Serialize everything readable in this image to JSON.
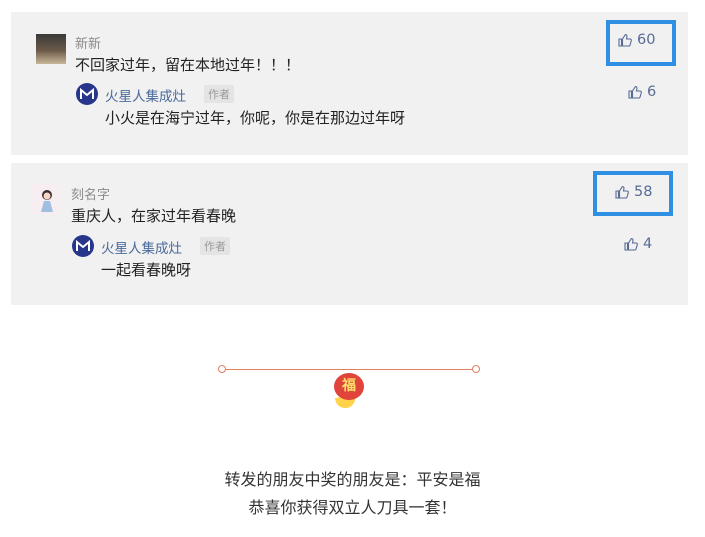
{
  "comments": [
    {
      "username": "新新",
      "text": "不回家过年，留在本地过年！！！",
      "likes": "60",
      "reply": {
        "name": "火星人集成灶",
        "tag": "作者",
        "text": "小火是在海宁过年，你呢，你是在那边过年呀",
        "likes": "6"
      }
    },
    {
      "username": "刻名字",
      "text": "重庆人，在家过年看春晚",
      "likes": "58",
      "reply": {
        "name": "火星人集成灶",
        "tag": "作者",
        "text": "一起看春晚呀",
        "likes": "4"
      }
    }
  ],
  "divider": {
    "badge": "福"
  },
  "footer": {
    "line1": "转发的朋友中奖的朋友是：平安是福",
    "line2": "恭喜你获得双立人刀具一套！"
  },
  "colors": {
    "highlight": "#2f8fe3",
    "link": "#576b95",
    "card_bg": "#f1f1f1"
  }
}
